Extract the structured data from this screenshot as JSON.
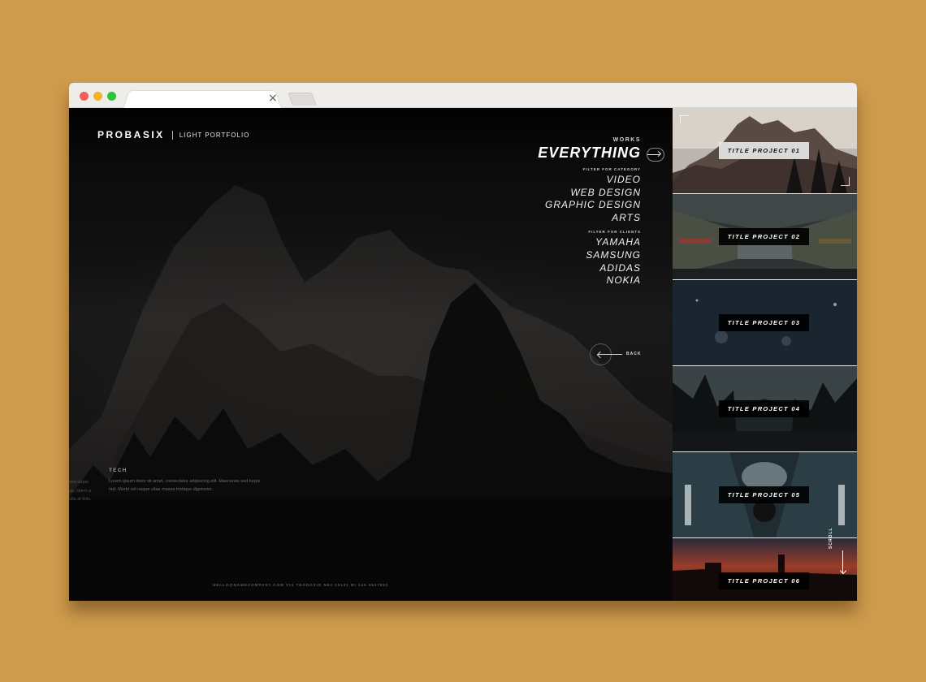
{
  "brand": {
    "name": "PROBASIX",
    "tagline": "LIGHT PORTFOLIO"
  },
  "menu": {
    "works_label": "WORKS",
    "active": "EVERYTHING",
    "category_heading": "FILTER FOR CATEGORY",
    "categories": [
      "VIDEO",
      "WEB DESIGN",
      "GRAPHIC DESIGN",
      "ARTS"
    ],
    "clients_heading": "FILTER FOR CLIENTS",
    "clients": [
      "YAMAHA",
      "SAMSUNG",
      "ADIDAS",
      "NOKIA"
    ]
  },
  "back_label": "BACK",
  "info": {
    "title": "TECH",
    "text_line1": "Lorem ipsum dolor sit amet, consectetur adipiscing elit. Maecenas sed turpis",
    "text_line2": "nisl. Morbi vel neque vitae massa tristique dignissim.",
    "left_lines": [
      "sed turpis",
      "ue, libero a",
      "ulla at felis."
    ]
  },
  "footer": "HELLO@NAMECOMPANY.COM   VIA TEODOSIO N83 20131 MI   345 3537892",
  "projects": [
    {
      "label": "TITLE PROJECT 01"
    },
    {
      "label": "TITLE PROJECT 02"
    },
    {
      "label": "TITLE PROJECT 03"
    },
    {
      "label": "TITLE PROJECT 04"
    },
    {
      "label": "TITLE PROJECT 05"
    },
    {
      "label": "TITLE PROJECT 06"
    }
  ],
  "scroll_label": "SCROLL",
  "colors": {
    "page_bg": "#CE9B4D",
    "hero_bg": "#0c0c0c",
    "accent_active": "#ffffff"
  }
}
